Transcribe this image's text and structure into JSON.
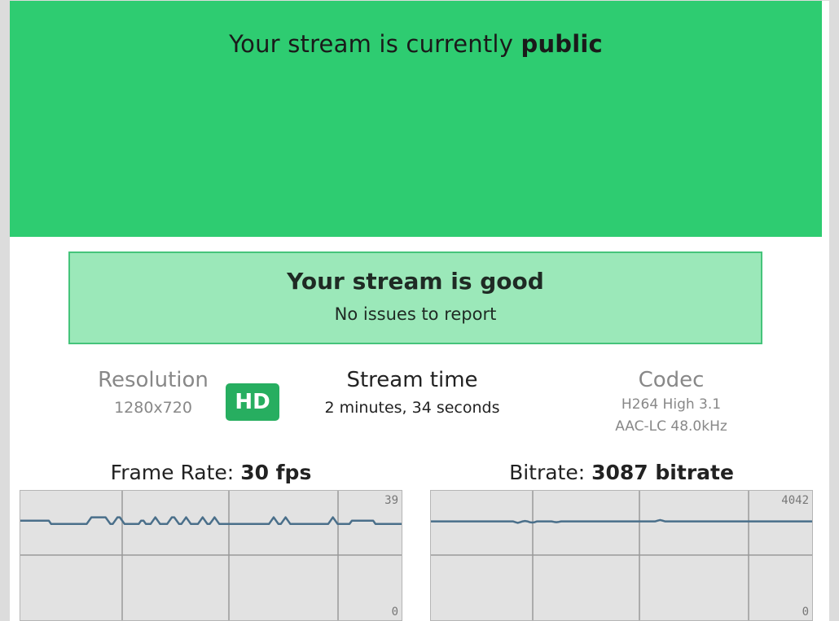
{
  "preview": {
    "title_prefix": "Your stream is currently ",
    "title_state": "public",
    "color": "#2ecc71"
  },
  "health": {
    "headline": "Your stream is good",
    "subtext": "No issues to report",
    "color": "#9be8b9"
  },
  "stats": {
    "resolution_label": "Resolution",
    "resolution_value": "1280x720",
    "quality_badge": "HD",
    "stream_time_label": "Stream time",
    "stream_time_value": "2 minutes, 34 seconds",
    "codec_label": "Codec",
    "codec_video": "H264 High 3.1",
    "codec_audio": "AAC-LC 48.0kHz"
  },
  "framerate": {
    "label": "Frame Rate: ",
    "value": "30 fps",
    "max_label": "39",
    "min_label": "0",
    "ymax": 39,
    "line_color": "#4a6f8a",
    "samples": [
      30,
      30,
      30,
      30,
      30,
      30,
      30,
      30,
      30,
      30,
      30,
      30,
      30,
      29,
      29,
      29,
      29,
      29,
      29,
      29,
      29,
      29,
      29,
      29,
      29,
      29,
      29,
      29,
      29,
      30,
      31,
      31,
      31,
      31,
      31,
      31,
      31,
      30,
      29,
      29,
      30,
      31,
      31,
      30,
      29,
      29,
      29,
      29,
      29,
      29,
      29,
      30,
      30,
      29,
      29,
      29,
      30,
      31,
      30,
      29,
      29,
      29,
      29,
      30,
      31,
      31,
      30,
      29,
      29,
      30,
      31,
      30,
      29,
      29,
      29,
      29,
      30,
      31,
      30,
      29,
      29,
      30,
      31,
      30,
      29,
      29,
      29,
      29,
      29,
      29,
      29,
      29,
      29,
      29,
      29,
      29,
      29,
      29,
      29,
      29,
      29,
      29,
      29,
      29,
      29,
      29,
      30,
      31,
      30,
      29,
      29,
      30,
      31,
      30,
      29,
      29,
      29,
      29,
      29,
      29,
      29,
      29,
      29,
      29,
      29,
      29,
      29,
      29,
      29,
      29,
      29,
      30,
      31,
      30,
      29,
      29,
      29,
      29,
      29,
      29,
      30,
      30,
      30,
      30,
      30,
      30,
      30,
      30,
      30,
      30,
      29,
      29,
      29,
      29,
      29,
      29,
      29,
      29,
      29,
      29,
      29,
      29
    ]
  },
  "bitrate": {
    "label": "Bitrate: ",
    "value": "3087 bitrate",
    "max_label": "4042",
    "min_label": "0",
    "ymax": 4042,
    "line_color": "#4a6f8a",
    "samples": [
      3087,
      3087,
      3087,
      3087,
      3087,
      3087,
      3087,
      3087,
      3087,
      3087,
      3087,
      3087,
      3087,
      3087,
      3087,
      3087,
      3087,
      3087,
      3087,
      3087,
      3087,
      3087,
      3087,
      3087,
      3087,
      3087,
      3087,
      3087,
      3087,
      3087,
      3087,
      3087,
      3087,
      3087,
      3087,
      3060,
      3040,
      3060,
      3087,
      3100,
      3087,
      3060,
      3050,
      3060,
      3087,
      3087,
      3087,
      3087,
      3087,
      3087,
      3087,
      3070,
      3060,
      3070,
      3087,
      3087,
      3087,
      3087,
      3087,
      3087,
      3087,
      3087,
      3087,
      3087,
      3087,
      3087,
      3087,
      3087,
      3087,
      3087,
      3087,
      3087,
      3087,
      3087,
      3087,
      3087,
      3087,
      3087,
      3087,
      3087,
      3087,
      3087,
      3087,
      3087,
      3087,
      3087,
      3087,
      3087,
      3087,
      3087,
      3087,
      3087,
      3087,
      3087,
      3110,
      3130,
      3110,
      3087,
      3087,
      3087,
      3087,
      3087,
      3087,
      3087,
      3087,
      3087,
      3087,
      3087,
      3087,
      3087,
      3087,
      3087,
      3087,
      3087,
      3087,
      3087,
      3087,
      3087,
      3087,
      3087,
      3087,
      3087,
      3087,
      3087,
      3087,
      3087,
      3087,
      3087,
      3087,
      3087,
      3087,
      3087,
      3087,
      3087,
      3087,
      3087,
      3087,
      3087,
      3087,
      3087,
      3087,
      3087,
      3087,
      3087,
      3087,
      3087,
      3087,
      3087,
      3087,
      3087,
      3087,
      3087,
      3087,
      3087,
      3087,
      3087,
      3087,
      3087,
      3087
    ]
  }
}
